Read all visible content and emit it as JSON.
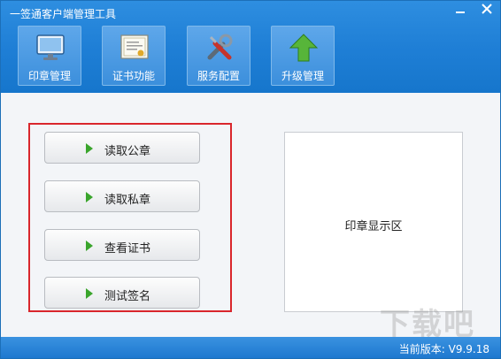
{
  "window": {
    "title": "一签通客户端管理工具"
  },
  "toolbar": {
    "items": [
      {
        "label": "印章管理",
        "icon": "monitor-icon"
      },
      {
        "label": "证书功能",
        "icon": "certificate-icon"
      },
      {
        "label": "服务配置",
        "icon": "tools-icon"
      },
      {
        "label": "升级管理",
        "icon": "upgrade-arrow-icon"
      }
    ]
  },
  "actions": {
    "buttons": [
      {
        "label": "读取公章"
      },
      {
        "label": "读取私章"
      },
      {
        "label": "查看证书"
      },
      {
        "label": "测试签名"
      }
    ]
  },
  "seal_area": {
    "label": "印章显示区"
  },
  "status": {
    "version": "当前版本: V9.9.18"
  },
  "colors": {
    "accent": "#1f7fd6",
    "highlight_border": "#d9262c",
    "play_icon": "#3aa52c"
  }
}
